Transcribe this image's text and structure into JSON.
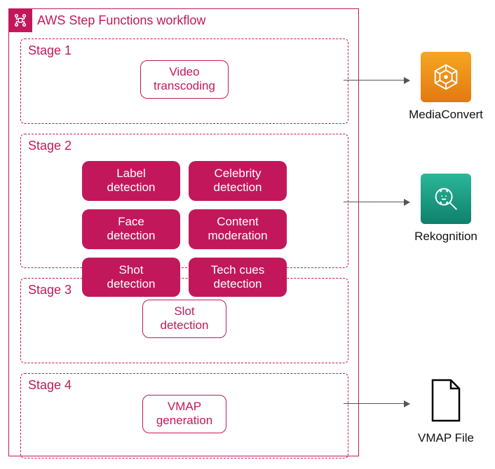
{
  "workflow": {
    "title": "AWS Step Functions workflow",
    "stages": [
      {
        "label": "Stage 1",
        "tasks": [
          "Video transcoding"
        ],
        "style": "outline"
      },
      {
        "label": "Stage 2",
        "tasks": [
          "Label detection",
          "Celebrity detection",
          "Face detection",
          "Content moderation",
          "Shot detection",
          "Tech cues detection"
        ],
        "style": "solid"
      },
      {
        "label": "Stage 3",
        "tasks": [
          "Slot detection"
        ],
        "style": "outline"
      },
      {
        "label": "Stage 4",
        "tasks": [
          "VMAP generation"
        ],
        "style": "outline"
      }
    ]
  },
  "targets": {
    "mediaconvert": "MediaConvert",
    "rekognition": "Rekognition",
    "vmap": "VMAP File"
  },
  "colors": {
    "accent": "#c2185b",
    "mediaconvert": "#e47911",
    "rekognition": "#16a085"
  }
}
